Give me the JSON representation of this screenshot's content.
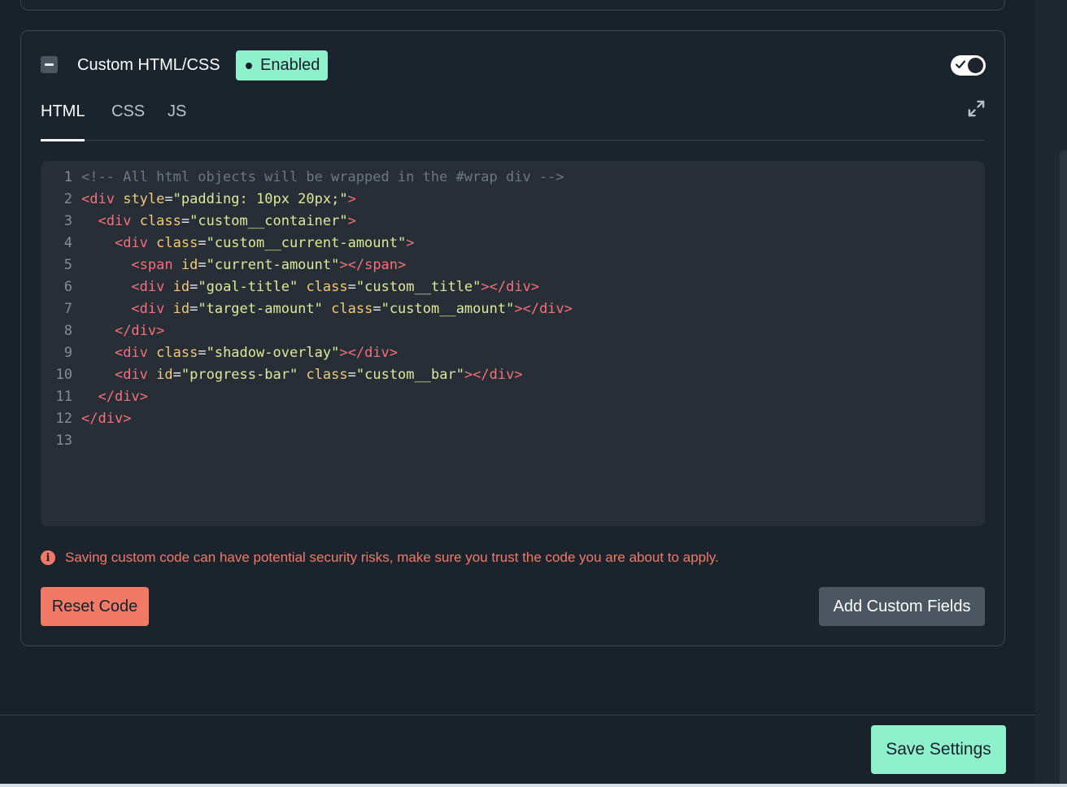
{
  "card": {
    "title": "Custom HTML/CSS",
    "status_badge": "Enabled",
    "toggle_on": true
  },
  "tabs": [
    {
      "label": "HTML",
      "active": true
    },
    {
      "label": "CSS",
      "active": false
    },
    {
      "label": "JS",
      "active": false
    }
  ],
  "editor": {
    "language": "html",
    "lines": [
      {
        "n": "1",
        "text": "<!-- All html objects will be wrapped in the #wrap div -->"
      },
      {
        "n": "2",
        "text": "<div style=\"padding: 10px 20px;\">"
      },
      {
        "n": "3",
        "text": "  <div class=\"custom__container\">"
      },
      {
        "n": "4",
        "text": "    <div class=\"custom__current-amount\">"
      },
      {
        "n": "5",
        "text": "      <span id=\"current-amount\"></span>"
      },
      {
        "n": "6",
        "text": "      <div id=\"goal-title\" class=\"custom__title\"></div>"
      },
      {
        "n": "7",
        "text": "      <div id=\"target-amount\" class=\"custom__amount\"></div>"
      },
      {
        "n": "8",
        "text": "    </div>"
      },
      {
        "n": "9",
        "text": "    <div class=\"shadow-overlay\"></div>"
      },
      {
        "n": "10",
        "text": "    <div id=\"progress-bar\" class=\"custom__bar\"></div>"
      },
      {
        "n": "11",
        "text": "  </div>"
      },
      {
        "n": "12",
        "text": "</div>"
      },
      {
        "n": "13",
        "text": ""
      }
    ]
  },
  "warning": {
    "icon": "info-icon",
    "text": "Saving custom code can have potential security risks, make sure you trust the code you are about to apply."
  },
  "buttons": {
    "reset": "Reset Code",
    "add_fields": "Add Custom Fields",
    "save": "Save Settings"
  },
  "colors": {
    "accent": "#8ff0cc",
    "danger": "#f07a66",
    "background": "#19222b",
    "editor_bg": "#272e35"
  }
}
